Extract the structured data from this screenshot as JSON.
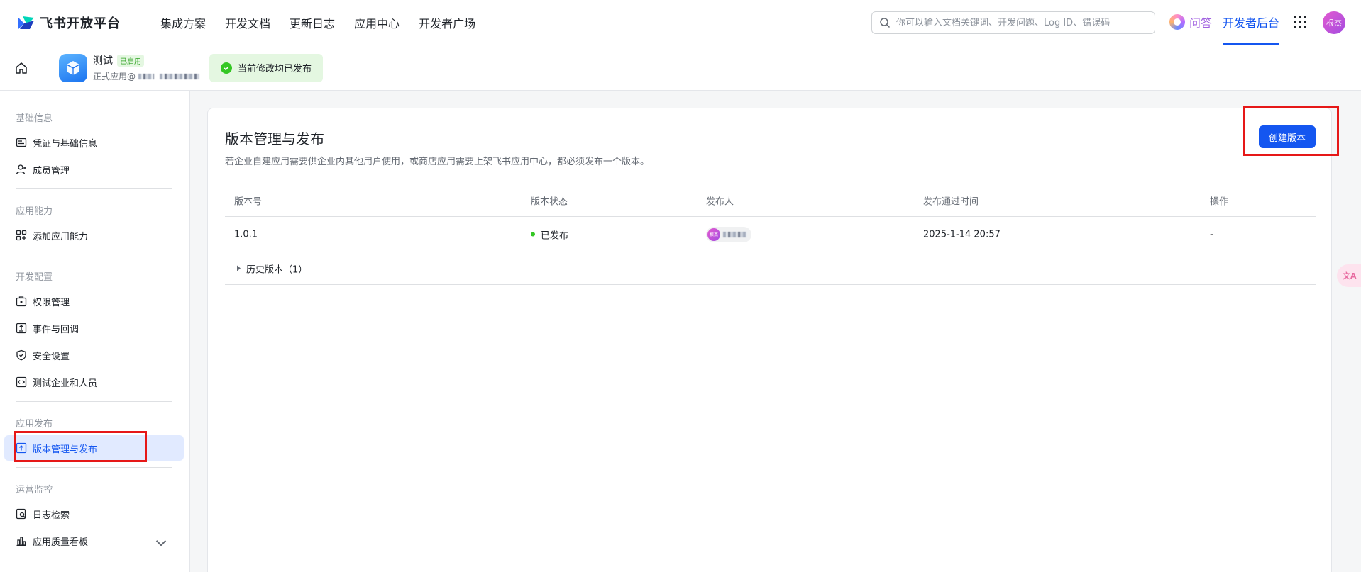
{
  "topnav": {
    "logo_text": "飞书开放平台",
    "links": [
      "集成方案",
      "开发文档",
      "更新日志",
      "应用中心",
      "开发者广场"
    ],
    "search_placeholder": "你可以输入文档关键词、开发问题、Log ID、错误码",
    "qa_label": "问答",
    "dev_console_label": "开发者后台",
    "avatar_text": "根杰"
  },
  "appbar": {
    "app_name": "测试",
    "app_badge": "已启用",
    "app_subtitle": "正式应用@",
    "publish_status": "当前修改均已发布"
  },
  "sidebar": {
    "sections": [
      {
        "title": "基础信息",
        "items": [
          "凭证与基础信息",
          "成员管理"
        ]
      },
      {
        "title": "应用能力",
        "items": [
          "添加应用能力"
        ]
      },
      {
        "title": "开发配置",
        "items": [
          "权限管理",
          "事件与回调",
          "安全设置",
          "测试企业和人员"
        ]
      },
      {
        "title": "应用发布",
        "items": [
          "版本管理与发布"
        ]
      },
      {
        "title": "运营监控",
        "items": [
          "日志检索",
          "应用质量看板"
        ]
      }
    ]
  },
  "main": {
    "title": "版本管理与发布",
    "description": "若企业自建应用需要供企业内其他用户使用，或商店应用需要上架飞书应用中心，都必须发布一个版本。",
    "create_button": "创建版本",
    "table": {
      "columns": [
        "版本号",
        "版本状态",
        "发布人",
        "发布通过时间",
        "操作"
      ],
      "rows": [
        {
          "version": "1.0.1",
          "status": "已发布",
          "publisher_avatar": "根杰",
          "time": "2025-1-14 20:57",
          "action": "-"
        }
      ],
      "history": "历史版本（1）"
    }
  },
  "colors": {
    "accent": "#1456f0",
    "success": "#34c724",
    "highlight_box": "#e61818"
  }
}
